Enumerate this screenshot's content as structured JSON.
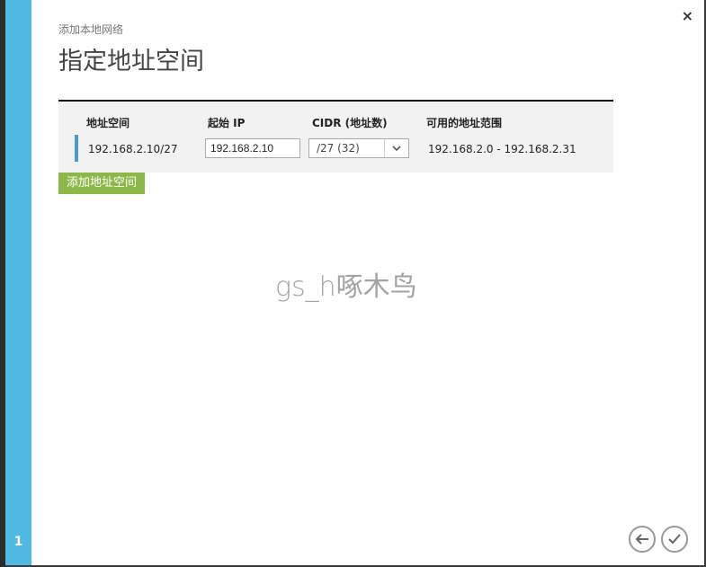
{
  "dialog": {
    "subtitle": "添加本地网络",
    "title": "指定地址空间",
    "step_number": "1",
    "close_glyph": "×"
  },
  "table": {
    "headers": [
      "地址空间",
      "起始 IP",
      "CIDR (地址数)",
      "可用的地址范围"
    ],
    "rows": [
      {
        "address_space": "192.168.2.10/27",
        "start_ip": "192.168.2.10",
        "cidr": "/27 (32)",
        "usable_range": "192.168.2.0 - 192.168.2.31"
      }
    ]
  },
  "add_button_label": "添加地址空间",
  "watermark": "gs_h啄木鸟",
  "colors": {
    "step_bar": "#4fb8e3",
    "accent": "#4a9bcf",
    "add_button": "#8cb84a"
  },
  "icons": {
    "close": "close-icon",
    "dropdown": "chevron-down-icon",
    "back": "arrow-left-icon",
    "confirm": "checkmark-icon"
  }
}
